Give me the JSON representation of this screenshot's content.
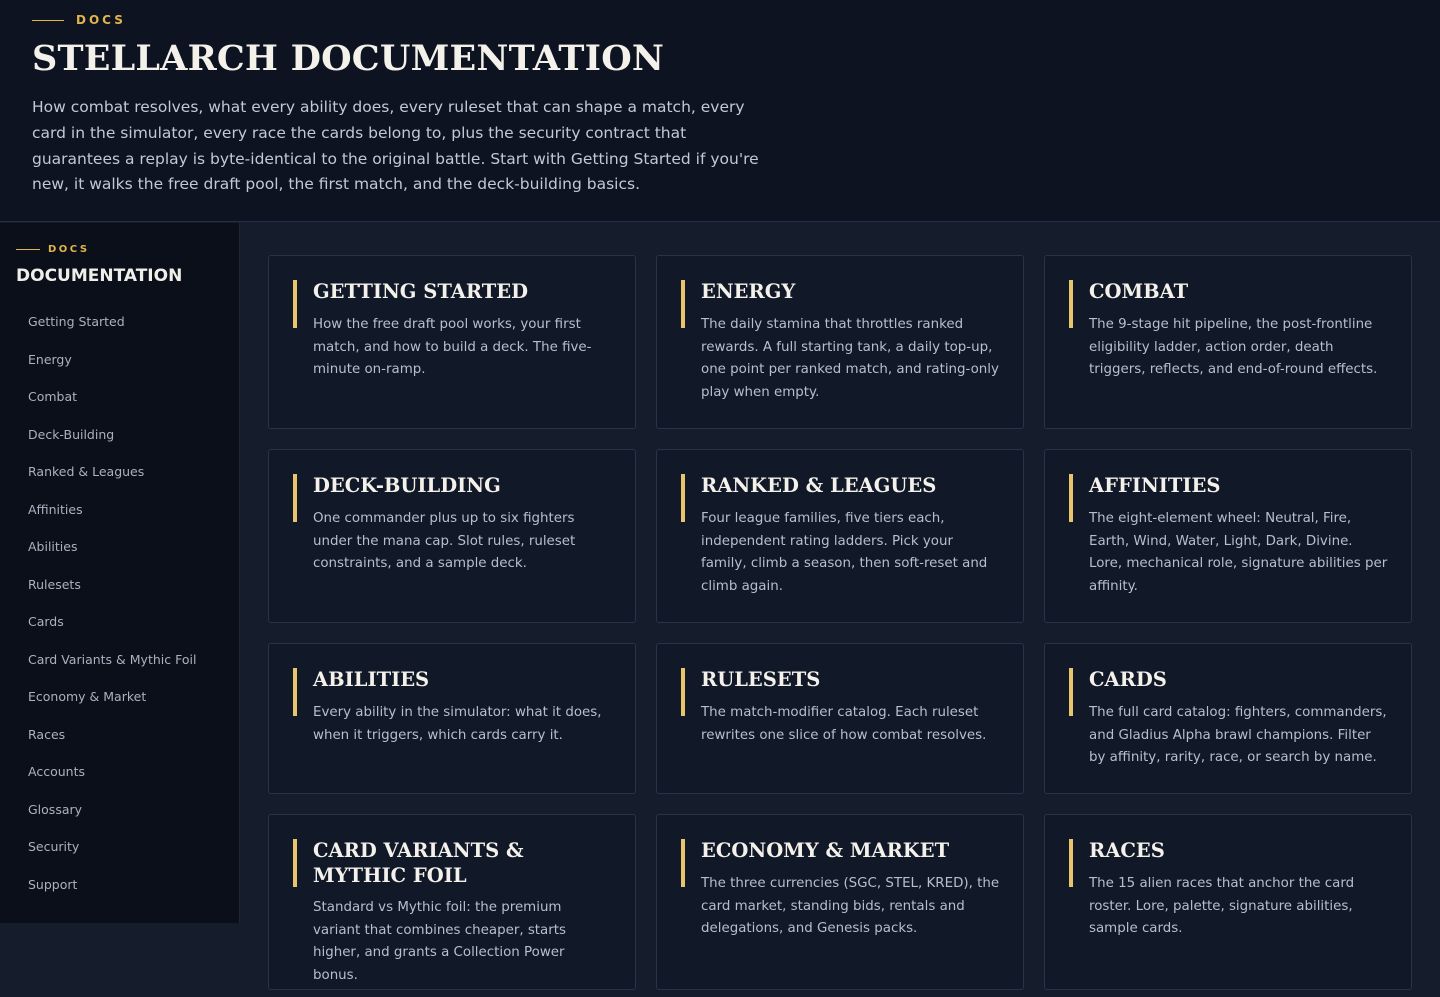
{
  "hero": {
    "eyebrow": "DOCS",
    "title": "STELLARCH DOCUMENTATION",
    "description": "How combat resolves, what every ability does, every ruleset that can shape a match, every card in the simulator, every race the cards belong to, plus the security contract that guarantees a replay is byte-identical to the original battle. Start with Getting Started if you're new, it walks the free draft pool, the first match, and the deck-building basics."
  },
  "sidebar": {
    "eyebrow": "DOCS",
    "title": "DOCUMENTATION",
    "items": [
      "Getting Started",
      "Energy",
      "Combat",
      "Deck-Building",
      "Ranked & Leagues",
      "Affinities",
      "Abilities",
      "Rulesets",
      "Cards",
      "Card Variants & Mythic Foil",
      "Economy & Market",
      "Races",
      "Accounts",
      "Glossary",
      "Security",
      "Support"
    ]
  },
  "cards": [
    {
      "title": "GETTING STARTED",
      "desc": "How the free draft pool works, your first match, and how to build a deck. The five-minute on-ramp."
    },
    {
      "title": "ENERGY",
      "desc": "The daily stamina that throttles ranked rewards. A full starting tank, a daily top-up, one point per ranked match, and rating-only play when empty."
    },
    {
      "title": "COMBAT",
      "desc": "The 9-stage hit pipeline, the post-frontline eligibility ladder, action order, death triggers, reflects, and end-of-round effects."
    },
    {
      "title": "DECK-BUILDING",
      "desc": "One commander plus up to six fighters under the mana cap. Slot rules, ruleset constraints, and a sample deck."
    },
    {
      "title": "RANKED & LEAGUES",
      "desc": "Four league families, five tiers each, independent rating ladders. Pick your family, climb a season, then soft-reset and climb again."
    },
    {
      "title": "AFFINITIES",
      "desc": "The eight-element wheel: Neutral, Fire, Earth, Wind, Water, Light, Dark, Divine. Lore, mechanical role, signature abilities per affinity."
    },
    {
      "title": "ABILITIES",
      "desc": "Every ability in the simulator: what it does, when it triggers, which cards carry it."
    },
    {
      "title": "RULESETS",
      "desc": "The match-modifier catalog. Each ruleset rewrites one slice of how combat resolves."
    },
    {
      "title": "CARDS",
      "desc": "The full card catalog: fighters, commanders, and Gladius Alpha brawl champions. Filter by affinity, rarity, race, or search by name."
    },
    {
      "title": "CARD VARIANTS & MYTHIC FOIL",
      "desc": "Standard vs Mythic foil: the premium variant that combines cheaper, starts higher, and grants a Collection Power bonus."
    },
    {
      "title": "ECONOMY & MARKET",
      "desc": "The three currencies (SGC, STEL, KRED), the card market, standing bids, rentals and delegations, and Genesis packs."
    },
    {
      "title": "RACES",
      "desc": "The 15 alien races that anchor the card roster. Lore, palette, signature abilities, sample cards."
    }
  ]
}
